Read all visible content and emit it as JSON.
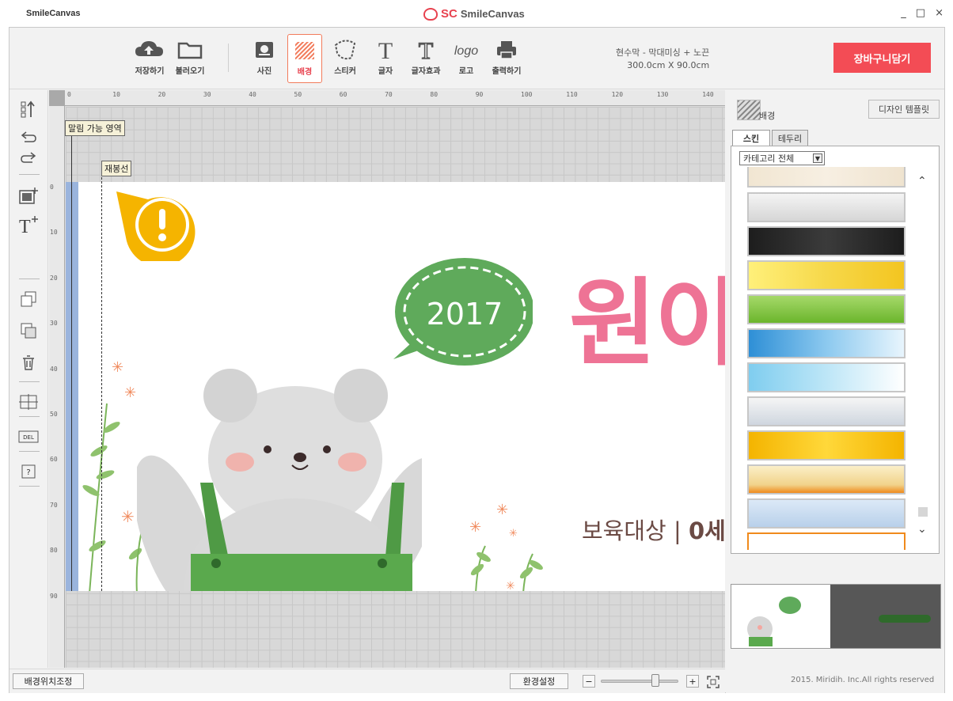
{
  "app": {
    "name": "SmileCanvas",
    "logo_mark": "SC",
    "logo_name": "SmileCanvas",
    "win_controls": [
      "_",
      "□",
      "×"
    ]
  },
  "toolbar": {
    "save": "저장하기",
    "load": "불러오기",
    "photo": "사진",
    "background": "배경",
    "sticker": "스티커",
    "text": "글자",
    "text_effect": "글자효과",
    "logo": "로고",
    "print": "출력하기",
    "logo_icon_text": "logo",
    "product_line1": "현수막 - 막대미싱 + 노끈",
    "product_line2": "300.0cm X 90.0cm",
    "cart": "장바구니담기"
  },
  "canvas": {
    "guide_roll_area": "말림 가능 영역",
    "guide_sewing": "재봉선",
    "bubble_text": "2017",
    "big_text": "원아",
    "sub_text_a": "보육대상",
    "sub_text_sep": " | ",
    "sub_text_b": "0세",
    "ruler_top": [
      "0",
      "10",
      "20",
      "30",
      "40",
      "50",
      "60",
      "70",
      "80",
      "90",
      "100",
      "110",
      "120",
      "130",
      "140"
    ],
    "ruler_left": [
      "0",
      "10",
      "20",
      "30",
      "40",
      "50",
      "60",
      "70",
      "80",
      "90"
    ]
  },
  "bottom": {
    "bg_position": "배경위치조정",
    "settings": "환경설정",
    "zoom_minus": "−",
    "zoom_plus": "+",
    "zoom_level": 0.7
  },
  "right_panel": {
    "title": "배경",
    "template_button": "디자인 템플릿",
    "tabs": [
      "스킨",
      "테두리"
    ],
    "category": "카테고리 전체",
    "copyright": "2015. Miridih. Inc.All rights reserved"
  },
  "colors": {
    "accent": "#f34c55",
    "active_tab_border": "#f27b5b",
    "bubble_green": "#5faa5b",
    "title_pink": "#ee7395"
  },
  "left_tools": [
    "layer-order-icon",
    "undo-icon",
    "redo-icon",
    "add-image-icon",
    "add-text-icon",
    "bring-front-icon",
    "send-back-icon",
    "trash-icon",
    "grid-icon",
    "delete-icon",
    "help-icon"
  ]
}
